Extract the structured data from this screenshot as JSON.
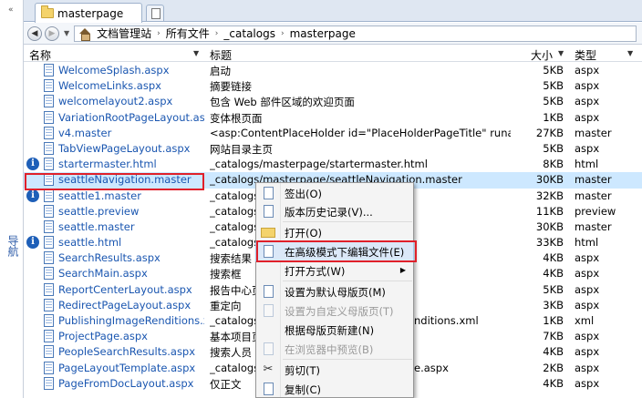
{
  "nav": {
    "label": "导航"
  },
  "tab": {
    "title": "masterpage"
  },
  "breadcrumbs": [
    "文档管理站",
    "所有文件",
    "_catalogs",
    "masterpage"
  ],
  "columns": {
    "name": "名称",
    "title": "标题",
    "size": "大小",
    "type": "类型"
  },
  "rows": [
    {
      "name": "WelcomeSplash.aspx",
      "title": "启动",
      "size": "5KB",
      "type": "aspx",
      "info": false
    },
    {
      "name": "WelcomeLinks.aspx",
      "title": "摘要链接",
      "size": "5KB",
      "type": "aspx",
      "info": false
    },
    {
      "name": "welcomelayout2.aspx",
      "title": "包含 Web 部件区域的欢迎页面",
      "size": "5KB",
      "type": "aspx",
      "info": false
    },
    {
      "name": "VariationRootPageLayout.aspx",
      "title": "变体根页面",
      "size": "1KB",
      "type": "aspx",
      "info": false
    },
    {
      "name": "v4.master",
      "title": "<asp:ContentPlaceHolder id=\"PlaceHolderPageTitle\" runat=\"server\"/>",
      "size": "27KB",
      "type": "master",
      "info": false
    },
    {
      "name": "TabViewPageLayout.aspx",
      "title": "网站目录主页",
      "size": "5KB",
      "type": "aspx",
      "info": false
    },
    {
      "name": "startermaster.html",
      "title": "_catalogs/masterpage/startermaster.html",
      "size": "8KB",
      "type": "html",
      "info": true
    },
    {
      "name": "seattleNavigation.master",
      "title": "_catalogs/masterpage/seattleNavigation.master",
      "size": "30KB",
      "type": "master",
      "info": false,
      "selected": true
    },
    {
      "name": "seattle1.master",
      "title": "_catalogs/",
      "size": "32KB",
      "type": "master",
      "info": true
    },
    {
      "name": "seattle.preview",
      "title": "_catalogs/",
      "size": "11KB",
      "type": "preview",
      "info": false
    },
    {
      "name": "seattle.master",
      "title": "_catalogs/",
      "size": "30KB",
      "type": "master",
      "info": false
    },
    {
      "name": "seattle.html",
      "title": "_catalogs/",
      "size": "33KB",
      "type": "html",
      "info": true
    },
    {
      "name": "SearchResults.aspx",
      "title": "搜索结果",
      "size": "4KB",
      "type": "aspx",
      "info": false
    },
    {
      "name": "SearchMain.aspx",
      "title": "搜索框",
      "size": "4KB",
      "type": "aspx",
      "info": false
    },
    {
      "name": "ReportCenterLayout.aspx",
      "title": "报告中心页",
      "size": "5KB",
      "type": "aspx",
      "info": false
    },
    {
      "name": "RedirectPageLayout.aspx",
      "title": "重定向",
      "size": "3KB",
      "type": "aspx",
      "info": false
    },
    {
      "name": "PublishingImageRenditions.xml",
      "title": "_catalogs/",
      "title_tail": "nditions.xml",
      "size": "1KB",
      "type": "xml",
      "info": false
    },
    {
      "name": "ProjectPage.aspx",
      "title": "基本项目页",
      "size": "7KB",
      "type": "aspx",
      "info": false
    },
    {
      "name": "PeopleSearchResults.aspx",
      "title": "搜索人员",
      "size": "4KB",
      "type": "aspx",
      "info": false
    },
    {
      "name": "PageLayoutTemplate.aspx",
      "title": "_catalogs/",
      "title_tail": "e.aspx",
      "size": "2KB",
      "type": "aspx",
      "info": false
    },
    {
      "name": "PageFromDocLayout.aspx",
      "title": "仅正文",
      "size": "4KB",
      "type": "aspx",
      "info": false
    }
  ],
  "context_menu": {
    "checkout": "签出(O)",
    "history": "版本历史记录(V)...",
    "open": "打开(O)",
    "edit_advanced": "在高级模式下编辑文件(E)",
    "open_with": "打开方式(W)",
    "set_default": "设置为默认母版页(M)",
    "set_custom": "设置为自定义母版页(T)",
    "new_from_master": "根据母版页新建(N)",
    "preview_browser": "在浏览器中预览(B)",
    "cut": "剪切(T)",
    "copy": "复制(C)"
  },
  "colors": {
    "highlight": "#e0202a",
    "selected_row": "#cde8ff",
    "link": "#1a56b0"
  }
}
